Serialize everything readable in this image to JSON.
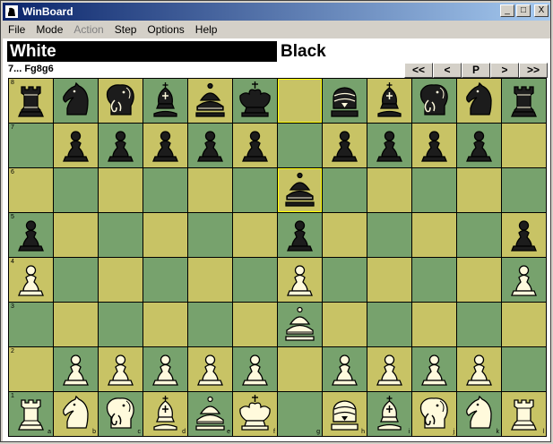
{
  "window": {
    "title": "WinBoard",
    "buttons": [
      "_",
      "□",
      "X"
    ]
  },
  "menu": [
    {
      "label": "File",
      "enabled": true
    },
    {
      "label": "Mode",
      "enabled": true
    },
    {
      "label": "Action",
      "enabled": false
    },
    {
      "label": "Step",
      "enabled": true
    },
    {
      "label": "Options",
      "enabled": true
    },
    {
      "label": "Help",
      "enabled": true
    }
  ],
  "clocks": {
    "white": "White",
    "black": "Black"
  },
  "last_move": "7... Fg8g6",
  "nav": [
    "<<",
    "<",
    "P",
    ">",
    ">>"
  ],
  "board": {
    "files": [
      "a",
      "b",
      "c",
      "d",
      "e",
      "f",
      "g",
      "h",
      "i",
      "j",
      "k",
      "l"
    ],
    "ranks": [
      "8",
      "7",
      "6",
      "5",
      "4",
      "3",
      "2",
      "1"
    ],
    "colors": {
      "light": "#c8c365",
      "dark": "#77a26d",
      "highlight": "#ffff00"
    },
    "highlighted": [
      "g8",
      "g6"
    ],
    "pieces": {
      "a8": "black-rook",
      "b8": "black-knight",
      "c8": "black-elephant",
      "d8": "black-bishop",
      "e8": "black-queen",
      "f8": "black-king",
      "h8": "black-ferz",
      "i8": "black-bishop",
      "j8": "black-elephant",
      "k8": "black-knight",
      "l8": "black-rook",
      "b7": "black-pawn",
      "c7": "black-pawn",
      "d7": "black-pawn",
      "e7": "black-pawn",
      "f7": "black-pawn",
      "h7": "black-pawn",
      "i7": "black-pawn",
      "j7": "black-pawn",
      "k7": "black-pawn",
      "g6": "black-queen",
      "a5": "black-pawn",
      "g5": "black-pawn",
      "l5": "black-pawn",
      "a4": "white-pawn",
      "g4": "white-pawn",
      "l4": "white-pawn",
      "g3": "white-queen",
      "b2": "white-pawn",
      "c2": "white-pawn",
      "d2": "white-pawn",
      "e2": "white-pawn",
      "f2": "white-pawn",
      "h2": "white-pawn",
      "i2": "white-pawn",
      "j2": "white-pawn",
      "k2": "white-pawn",
      "a1": "white-rook",
      "b1": "white-knight",
      "c1": "white-elephant",
      "d1": "white-bishop",
      "e1": "white-queen",
      "f1": "white-king",
      "h1": "white-ferz",
      "i1": "white-bishop",
      "j1": "white-elephant",
      "k1": "white-knight",
      "l1": "white-rook"
    }
  }
}
